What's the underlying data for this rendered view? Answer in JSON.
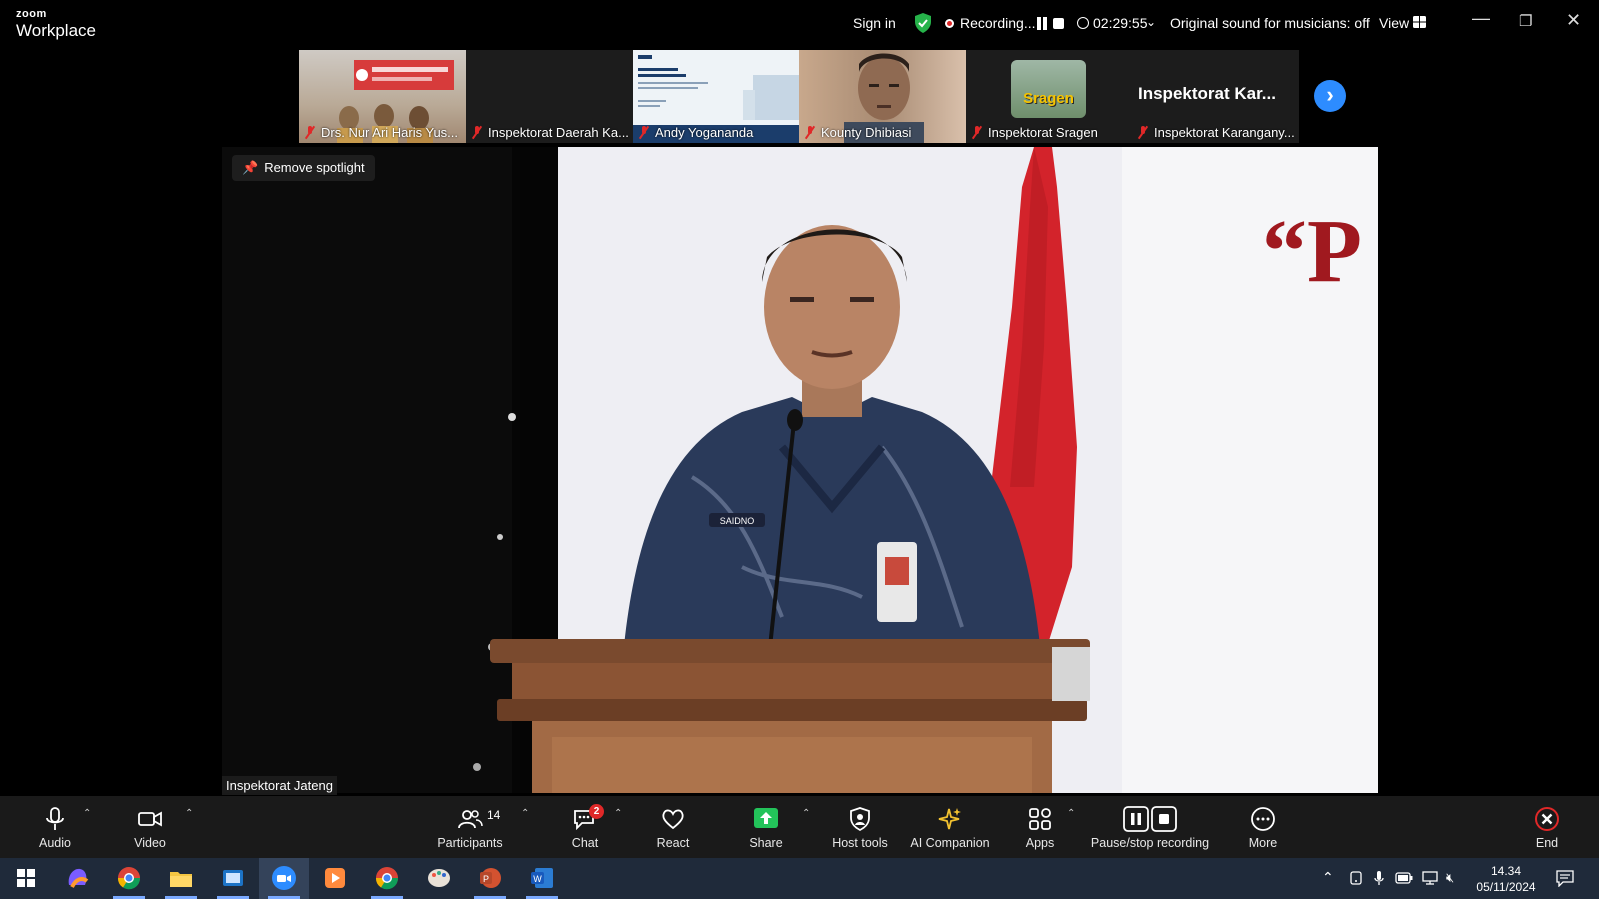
{
  "app": {
    "logo_top": "zoom",
    "logo_bottom": "Workplace"
  },
  "topbar": {
    "sign_in": "Sign in",
    "recording_label": "Recording...",
    "timer": "02:29:55",
    "original_sound": "Original sound for musicians: off",
    "view": "View"
  },
  "thumbnails": [
    {
      "name": "Drs. Nur Ari Haris Yus...",
      "muted": true
    },
    {
      "name": "Inspektorat Daerah Ka...",
      "muted": true
    },
    {
      "name": "Andy Yogananda",
      "muted": true
    },
    {
      "name": "Kounty Dhibiasi",
      "muted": true
    },
    {
      "name": "Inspektorat Sragen",
      "muted": true,
      "image_text": "Sragen"
    },
    {
      "name": "Inspektorat Karangany...",
      "muted": true,
      "display_name": "Inspektorat Kar..."
    }
  ],
  "spotlight": {
    "remove_label": "Remove spotlight",
    "speaker_name": "Inspektorat Jateng",
    "name_tag": "SAIDNO",
    "banner_text": "“P"
  },
  "toolbar": {
    "audio": "Audio",
    "video": "Video",
    "participants": "Participants",
    "participants_count": "14",
    "chat": "Chat",
    "chat_badge": "2",
    "react": "React",
    "share": "Share",
    "host_tools": "Host tools",
    "ai_companion": "AI Companion",
    "apps": "Apps",
    "pause_stop": "Pause/stop recording",
    "more": "More",
    "end": "End"
  },
  "taskbar": {
    "time": "14.34",
    "date": "05/11/2024",
    "apps": [
      "start-icon",
      "copilot-icon",
      "chrome-icon",
      "file-explorer-icon",
      "outlook-icon",
      "zoom-icon",
      "media-player-icon",
      "chrome-icon",
      "paint-icon",
      "powerpoint-icon",
      "word-icon"
    ]
  },
  "colors": {
    "accent": "#2d8cff",
    "share_green": "#23c35a",
    "record_red": "#e02828",
    "end_red": "#e02828",
    "shield_green": "#26b34a"
  }
}
